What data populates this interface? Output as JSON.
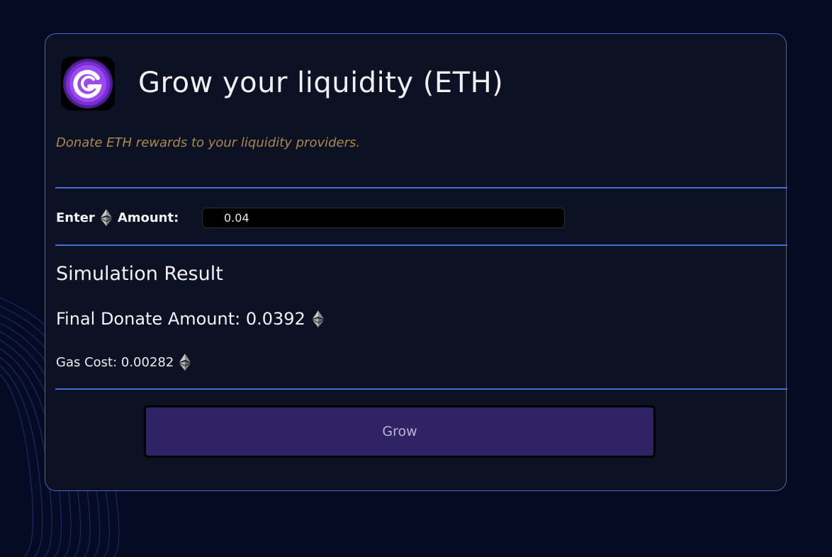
{
  "header": {
    "logo_icon": "g-swirl-logo-icon",
    "title": "Grow your liquidity (ETH)"
  },
  "subtitle": "Donate ETH rewards to your liquidity providers.",
  "amount": {
    "label_prefix": "Enter",
    "label_suffix": "Amount:",
    "icon": "ethereum-icon",
    "value": "0.04"
  },
  "simulation": {
    "title": "Simulation Result",
    "final_donate_label": "Final Donate Amount: 0.0392",
    "gas_cost_label": "Gas Cost: 0.00282"
  },
  "actions": {
    "grow_label": "Grow"
  },
  "colors": {
    "background": "#060b24",
    "card": "#0c1124",
    "card_border": "#4a63c2",
    "divider": "#4a6ad6",
    "subtitle": "#a88a4e",
    "button": "#2f2366",
    "logo_accent": "#8a2be2"
  }
}
